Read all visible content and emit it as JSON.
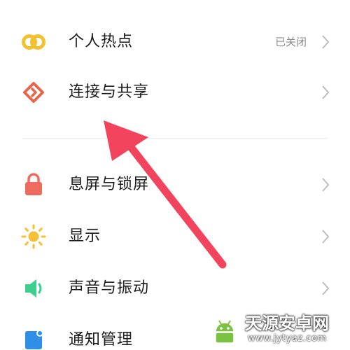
{
  "settings": {
    "items": [
      {
        "label": "个人热点",
        "status": "已关闭",
        "icon": "hotspot-icon"
      },
      {
        "label": "连接与共享",
        "status": "",
        "icon": "connection-sharing-icon"
      },
      {
        "label": "息屏与锁屏",
        "status": "",
        "icon": "lock-icon"
      },
      {
        "label": "显示",
        "status": "",
        "icon": "sun-icon"
      },
      {
        "label": "声音与振动",
        "status": "",
        "icon": "speaker-icon"
      },
      {
        "label": "通知管理",
        "status": "",
        "icon": "notification-icon"
      }
    ]
  },
  "watermark": {
    "title": "天源安卓网",
    "url": "www.jytyaz.com"
  },
  "colors": {
    "hotspot": "#f2c12e",
    "connection": "#e8644a",
    "lock": "#ee6b5f",
    "display": "#f7c034",
    "sound": "#3ccf8e",
    "notification": "#2f8fe8",
    "arrow": "#f2445c"
  }
}
